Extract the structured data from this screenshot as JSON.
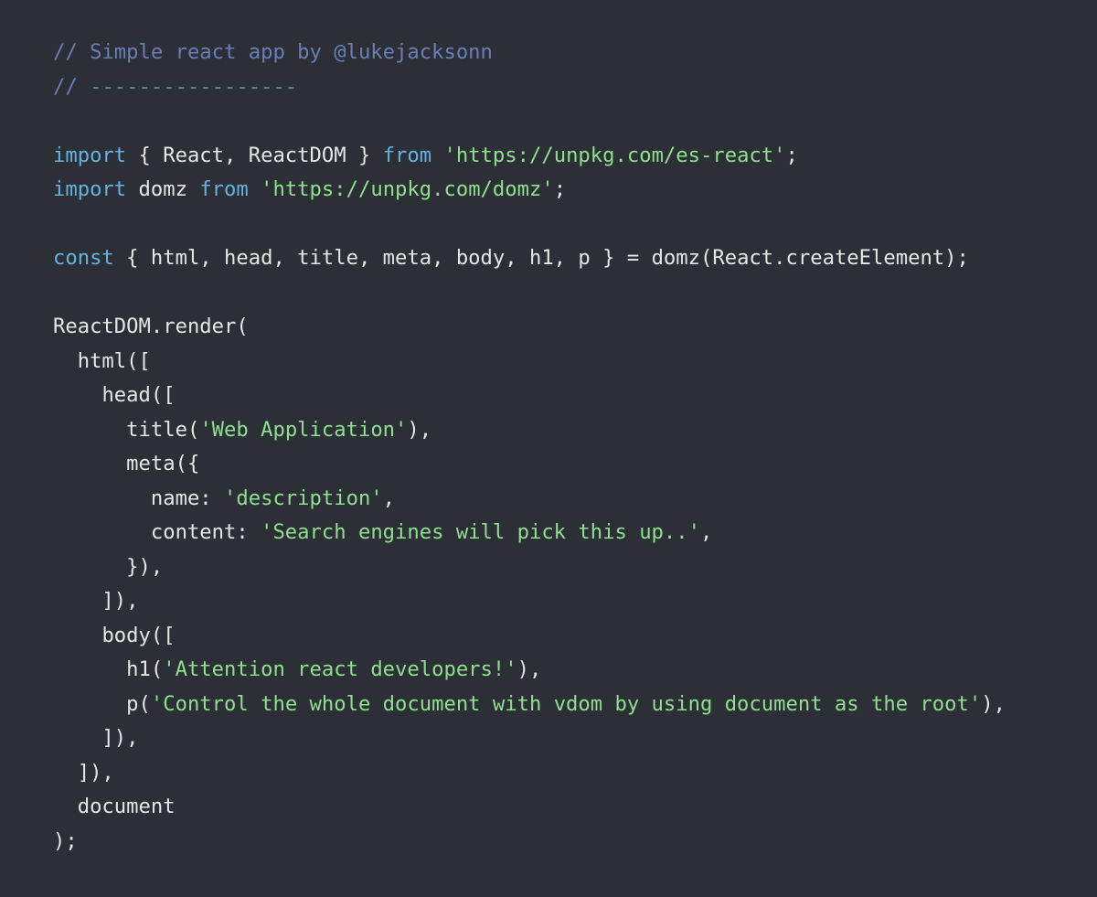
{
  "colors": {
    "background": "#2d2f36",
    "comment": "#6b7db6",
    "keyword": "#62b3e0",
    "string": "#8ee08e",
    "function": "#f0e9a0",
    "plain": "#e6e6e6"
  },
  "code_lines": [
    [
      {
        "k": "comment",
        "t": "// Simple react app by @lukejacksonn"
      }
    ],
    [
      {
        "k": "comment",
        "t": "// -----------------"
      }
    ],
    [],
    [
      {
        "k": "keyword",
        "t": "import"
      },
      {
        "k": "plain",
        "t": " { React, ReactDOM } "
      },
      {
        "k": "keyword",
        "t": "from"
      },
      {
        "k": "plain",
        "t": " "
      },
      {
        "k": "string",
        "t": "'https://unpkg.com/es-react'"
      },
      {
        "k": "plain",
        "t": ";"
      }
    ],
    [
      {
        "k": "keyword",
        "t": "import"
      },
      {
        "k": "plain",
        "t": " domz "
      },
      {
        "k": "keyword",
        "t": "from"
      },
      {
        "k": "plain",
        "t": " "
      },
      {
        "k": "string",
        "t": "'https://unpkg.com/domz'"
      },
      {
        "k": "plain",
        "t": ";"
      }
    ],
    [],
    [
      {
        "k": "keyword",
        "t": "const"
      },
      {
        "k": "plain",
        "t": " { html, head, title, meta, body, h1, p } = "
      },
      {
        "k": "function",
        "t": "domz"
      },
      {
        "k": "plain",
        "t": "(React.createElement);"
      }
    ],
    [],
    [
      {
        "k": "plain",
        "t": "ReactDOM."
      },
      {
        "k": "function",
        "t": "render"
      },
      {
        "k": "plain",
        "t": "("
      }
    ],
    [
      {
        "k": "plain",
        "t": "  "
      },
      {
        "k": "function",
        "t": "html"
      },
      {
        "k": "plain",
        "t": "(["
      }
    ],
    [
      {
        "k": "plain",
        "t": "    "
      },
      {
        "k": "function",
        "t": "head"
      },
      {
        "k": "plain",
        "t": "(["
      }
    ],
    [
      {
        "k": "plain",
        "t": "      "
      },
      {
        "k": "function",
        "t": "title"
      },
      {
        "k": "plain",
        "t": "("
      },
      {
        "k": "string",
        "t": "'Web Application'"
      },
      {
        "k": "plain",
        "t": "),"
      }
    ],
    [
      {
        "k": "plain",
        "t": "      "
      },
      {
        "k": "function",
        "t": "meta"
      },
      {
        "k": "plain",
        "t": "({"
      }
    ],
    [
      {
        "k": "plain",
        "t": "        name: "
      },
      {
        "k": "string",
        "t": "'description'"
      },
      {
        "k": "plain",
        "t": ","
      }
    ],
    [
      {
        "k": "plain",
        "t": "        content: "
      },
      {
        "k": "string",
        "t": "'Search engines will pick this up..'"
      },
      {
        "k": "plain",
        "t": ","
      }
    ],
    [
      {
        "k": "plain",
        "t": "      }),"
      }
    ],
    [
      {
        "k": "plain",
        "t": "    ]),"
      }
    ],
    [
      {
        "k": "plain",
        "t": "    "
      },
      {
        "k": "function",
        "t": "body"
      },
      {
        "k": "plain",
        "t": "(["
      }
    ],
    [
      {
        "k": "plain",
        "t": "      "
      },
      {
        "k": "function",
        "t": "h1"
      },
      {
        "k": "plain",
        "t": "("
      },
      {
        "k": "string",
        "t": "'Attention react developers!'"
      },
      {
        "k": "plain",
        "t": "),"
      }
    ],
    [
      {
        "k": "plain",
        "t": "      "
      },
      {
        "k": "function",
        "t": "p"
      },
      {
        "k": "plain",
        "t": "("
      },
      {
        "k": "string",
        "t": "'Control the whole document with vdom by using document as the root'"
      },
      {
        "k": "plain",
        "t": "),"
      }
    ],
    [
      {
        "k": "plain",
        "t": "    ]),"
      }
    ],
    [
      {
        "k": "plain",
        "t": "  ]),"
      }
    ],
    [
      {
        "k": "plain",
        "t": "  document"
      }
    ],
    [
      {
        "k": "plain",
        "t": ");"
      }
    ]
  ]
}
